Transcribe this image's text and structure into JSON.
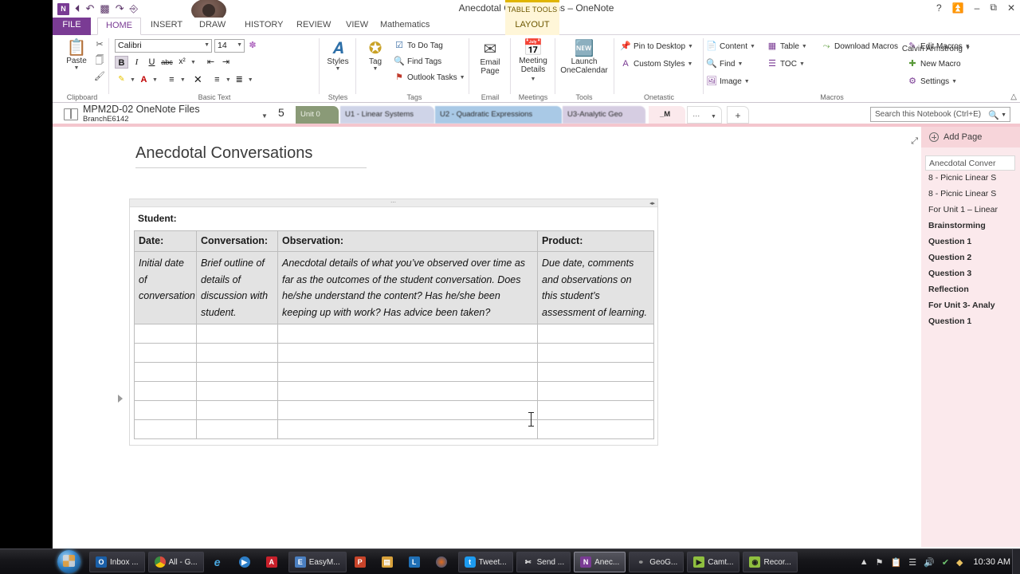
{
  "window": {
    "title": "Anecdotal Conversations – OneNote",
    "contextual_tools_label": "TABLE TOOLS",
    "user": "Calvin Armstrong",
    "quick_access": [
      "onenote-logo",
      "back",
      "undo",
      "dock",
      "redo",
      "touch-mode"
    ],
    "controls": [
      "?",
      "ribbon-display-options",
      "minimize",
      "restore",
      "close"
    ]
  },
  "ribbon": {
    "tabs": [
      {
        "label": "FILE",
        "kind": "file"
      },
      {
        "label": "HOME",
        "kind": "active"
      },
      {
        "label": "INSERT",
        "kind": "normal"
      },
      {
        "label": "DRAW",
        "kind": "normal"
      },
      {
        "label": "HISTORY",
        "kind": "normal"
      },
      {
        "label": "REVIEW",
        "kind": "normal"
      },
      {
        "label": "VIEW",
        "kind": "normal"
      },
      {
        "label": "Mathematics",
        "kind": "normal"
      },
      {
        "label": "LAYOUT",
        "kind": "layout"
      }
    ],
    "groups": {
      "clipboard": {
        "label": "Clipboard",
        "paste": "Paste",
        "cut": "Cut",
        "copy": "Copy",
        "format_painter": "Format Painter"
      },
      "basic_text": {
        "label": "Basic Text",
        "font_name": "Calibri",
        "font_size": "14",
        "buttons": [
          "B",
          "I",
          "U",
          "abc",
          "x²"
        ],
        "clear_formatting": "Clear Formatting"
      },
      "styles": {
        "label": "Styles",
        "button": "Styles"
      },
      "tags": {
        "label": "Tags",
        "tag_button": "Tag",
        "to_do_tag": "To Do Tag",
        "find_tags": "Find Tags",
        "outlook_tasks": "Outlook Tasks"
      },
      "email": {
        "label": "Email",
        "email_page": "Email\nPage",
        "email_page_l1": "Email",
        "email_page_l2": "Page"
      },
      "meetings": {
        "label": "Meetings",
        "l1": "Meeting",
        "l2": "Details"
      },
      "tools": {
        "label": "Tools",
        "l1": "Launch",
        "l2": "OneCalendar"
      },
      "onetastic": {
        "label": "Onetastic",
        "pin_to_desktop": "Pin to Desktop",
        "custom_styles": "Custom Styles"
      },
      "macros": {
        "label": "Macros",
        "content": "Content",
        "find": "Find",
        "image": "Image",
        "table": "Table",
        "toc": "TOC",
        "download_macros": "Download Macros",
        "edit_macros": "Edit Macros",
        "new_macro": "New Macro",
        "settings": "Settings"
      }
    }
  },
  "notebook_bar": {
    "notebook_name": "MPM2D-02 OneNote Files",
    "notebook_branch": "BranchE6142",
    "unread_count": "5",
    "sections": [
      {
        "label": "Unit 0",
        "color": "#8a9a77",
        "selected": false
      },
      {
        "label": "U1 - Linear Systems",
        "color": "#cfd4e8",
        "selected": false
      },
      {
        "label": "U2 - Quadratic Expressions",
        "color": "#a9c9e6",
        "selected": false
      },
      {
        "label": "U3-Analytic Geo",
        "color": "#d6cde2",
        "selected": false
      },
      {
        "label": "_M",
        "color": "#f8dde2",
        "selected": true
      }
    ],
    "overflow_label": "…",
    "new_section_label": "+",
    "search_placeholder": "Search this Notebook (Ctrl+E)"
  },
  "page": {
    "title": "Anecdotal Conversations",
    "student_label": "Student:",
    "table": {
      "headers": [
        "Date:",
        "Conversation:",
        "Observation:",
        "Product:"
      ],
      "filled_row": [
        "Initial date of conversation",
        "Brief outline of details of discussion with student.",
        "Anecdotal details of what you’ve observed over time as far as the outcomes of the student conversation.  Does he/she understand the content?  Has he/she been keeping up with work? Has advice been taken?",
        "Due date, comments and observations on this student’s assessment of learning."
      ],
      "empty_rows": 6
    }
  },
  "page_list": {
    "add_page_label": "Add Page",
    "pages": [
      {
        "label": "Anecdotal Conver",
        "selected": true,
        "bold": false
      },
      {
        "label": "8 - Picnic Linear S",
        "selected": false,
        "bold": false
      },
      {
        "label": "8 - Picnic Linear S",
        "selected": false,
        "bold": false
      },
      {
        "label": "For Unit 1 – Linear",
        "selected": false,
        "bold": false
      },
      {
        "label": "Brainstorming",
        "selected": false,
        "bold": true
      },
      {
        "label": "Question 1",
        "selected": false,
        "bold": true
      },
      {
        "label": "Question 2",
        "selected": false,
        "bold": true
      },
      {
        "label": "Question 3",
        "selected": false,
        "bold": true
      },
      {
        "label": "Reflection",
        "selected": false,
        "bold": true
      },
      {
        "label": "For Unit 3- Analy",
        "selected": false,
        "bold": true
      },
      {
        "label": "Question 1",
        "selected": false,
        "bold": true
      }
    ]
  },
  "taskbar": {
    "start_label": "Start",
    "items": [
      {
        "label": "Inbox ...",
        "icon": "outlook-icon",
        "color": "#1a5fa8",
        "glyph": "O",
        "active": false
      },
      {
        "label": "All - G...",
        "icon": "chrome-icon",
        "color": "#d94b3d",
        "glyph": "",
        "active": false
      },
      {
        "label": "",
        "icon": "internet-explorer-icon",
        "color": "#1b7ec2",
        "glyph": "e",
        "active": false
      },
      {
        "label": "",
        "icon": "media-player-icon",
        "color": "#2d7ec7",
        "glyph": "▶",
        "active": false
      },
      {
        "label": "",
        "icon": "acrobat-reader-icon",
        "color": "#c8202b",
        "glyph": "A",
        "active": false
      },
      {
        "label": "EasyM...",
        "icon": "easymatrix-icon",
        "color": "#4a7fc1",
        "glyph": "E",
        "active": false
      },
      {
        "label": "",
        "icon": "powerpoint-icon",
        "color": "#c8442a",
        "glyph": "P",
        "active": false
      },
      {
        "label": "",
        "icon": "explorer-icon",
        "color": "#d8a23c",
        "glyph": "▤",
        "active": false
      },
      {
        "label": "",
        "icon": "lync-icon",
        "color": "#1f6fb5",
        "glyph": "L",
        "active": false
      },
      {
        "label": "",
        "icon": "firefox-icon",
        "color": "#e06a1b",
        "glyph": "●",
        "active": false
      },
      {
        "label": "Tweet...",
        "icon": "twitter-icon",
        "color": "#1d9bf0",
        "glyph": "t",
        "active": false
      },
      {
        "label": "Send ...",
        "icon": "snipping-tool-icon",
        "color": "#8a8a8a",
        "glyph": "✂",
        "active": false
      },
      {
        "label": "Anec...",
        "icon": "onenote-icon",
        "color": "#7a3b94",
        "glyph": "N",
        "active": true
      },
      {
        "label": "GeoG...",
        "icon": "geogebra-icon",
        "color": "#5b5b5b",
        "glyph": "◌",
        "active": false
      },
      {
        "label": "Camt...",
        "icon": "camtasia-icon",
        "color": "#8fbf3f",
        "glyph": "◩",
        "active": false
      },
      {
        "label": "Recor...",
        "icon": "camtasia-recorder-icon",
        "color": "#8fbf3f",
        "glyph": "◪",
        "active": false
      }
    ],
    "tray": [
      "show-hidden-icons-icon",
      "flag-icon",
      "action-center-icon",
      "network-icon",
      "volume-icon",
      "antivirus-icon",
      "dropbox-icon"
    ],
    "clock": "10:30 AM"
  }
}
